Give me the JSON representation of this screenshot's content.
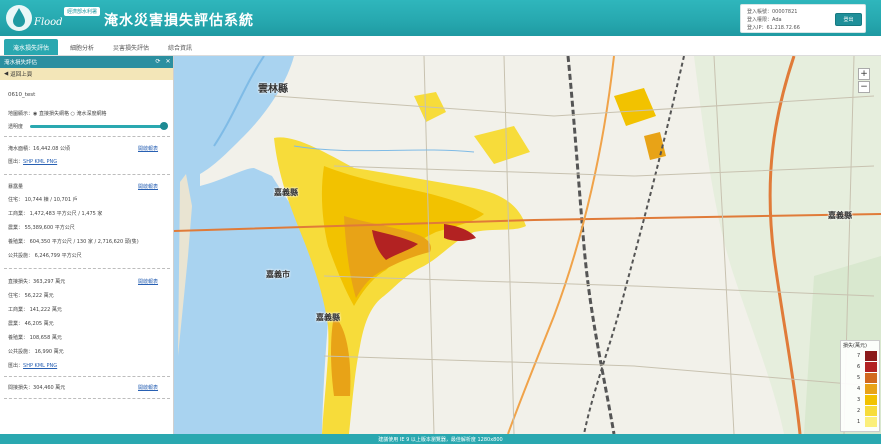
{
  "header": {
    "title": "淹水災害損失評估系統",
    "logo_script": "Flood",
    "logo_badge": "經濟部水利署",
    "user_lines": [
      "登入帳號：00007821",
      "登入權限：Ada",
      "登入IP：61.218.72.66"
    ],
    "logout": "登出"
  },
  "tabs": [
    {
      "label": "淹水損失評估",
      "active": true
    },
    {
      "label": "細胞分析",
      "active": false
    },
    {
      "label": "災害損失評估",
      "active": false
    },
    {
      "label": "綜合資訊",
      "active": false
    }
  ],
  "sidebar": {
    "panel_title": "淹水損失評估",
    "back_label": "返回上頁",
    "scenario_name": "0610_test",
    "display_options": "地圖顯示：◉ 直接損失網格  ○ 淹水深度網格",
    "opacity_label": "透明度",
    "opacity_value": 1.0,
    "area_label": "淹水面積：",
    "area_value": "16,442.08 公頃",
    "export_label": "匯出：",
    "export_formats": "SHP KML PNG",
    "report_link": "開啟報表",
    "exposure_title": "暴露量",
    "exposure_lines": [
      "住宅：  10,744 棟 / 10,701 戶",
      "工商業：  1,472,483 平方公尺 / 1,475 家",
      "農業：  55,389,600 平方公尺",
      "養殖業：  604,350 平方公尺 / 130 家 / 2,716,620 頭(隻)",
      "公共設施：  6,246,799 平方公尺"
    ],
    "direct_title": "直接損失",
    "direct_total": "363,297 萬元",
    "direct_lines": [
      "住宅：  56,222 萬元",
      "工商業：  141,222 萬元",
      "農業：  46,205 萬元",
      "養殖業：  108,658 萬元",
      "公共設施：  16,990 萬元"
    ],
    "indirect_title": "間接損失",
    "indirect_total": "304,460 萬元"
  },
  "map": {
    "labels": [
      {
        "text": "雲林縣"
      },
      {
        "text": "嘉義縣"
      },
      {
        "text": "嘉義市"
      },
      {
        "text": "嘉義縣"
      },
      {
        "text": "嘉義縣"
      }
    ],
    "zoom_in": "+",
    "zoom_out": "−",
    "legend_title": "損失(萬元)",
    "legend_levels": [
      "7",
      "6",
      "5",
      "4",
      "3",
      "2",
      "1"
    ],
    "legend_colors": [
      "#8b1a1a",
      "#b22222",
      "#d2691e",
      "#e8a317",
      "#f2c200",
      "#f7dc3a",
      "#fbef7a"
    ]
  },
  "footer": "建議使用 IE 9 以上版本瀏覽器，最佳解析度 1280x800"
}
